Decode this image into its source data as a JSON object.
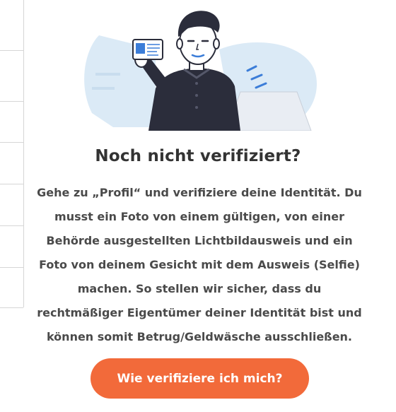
{
  "heading": "Noch nicht verifiziert?",
  "description": "Gehe zu „Profil“ und verifiziere deine Identität. Du musst ein Foto von einem gültigen, von einer Behörde ausgestellten Lichtbildausweis und ein Foto von deinem Gesicht mit dem Ausweis (Selfie) machen. So stellen wir sicher, dass du rechtmäßiger Eigentümer deiner Identität bist und können somit Betrug/Geldwäsche ausschließen.",
  "cta_label": "Wie verifiziere ich mich?",
  "colors": {
    "accent": "#f26a3a",
    "illustration_blue": "#dbeaf6",
    "ink": "#2b2d3b"
  },
  "icons": [
    "id-card-icon",
    "person-illustration"
  ]
}
